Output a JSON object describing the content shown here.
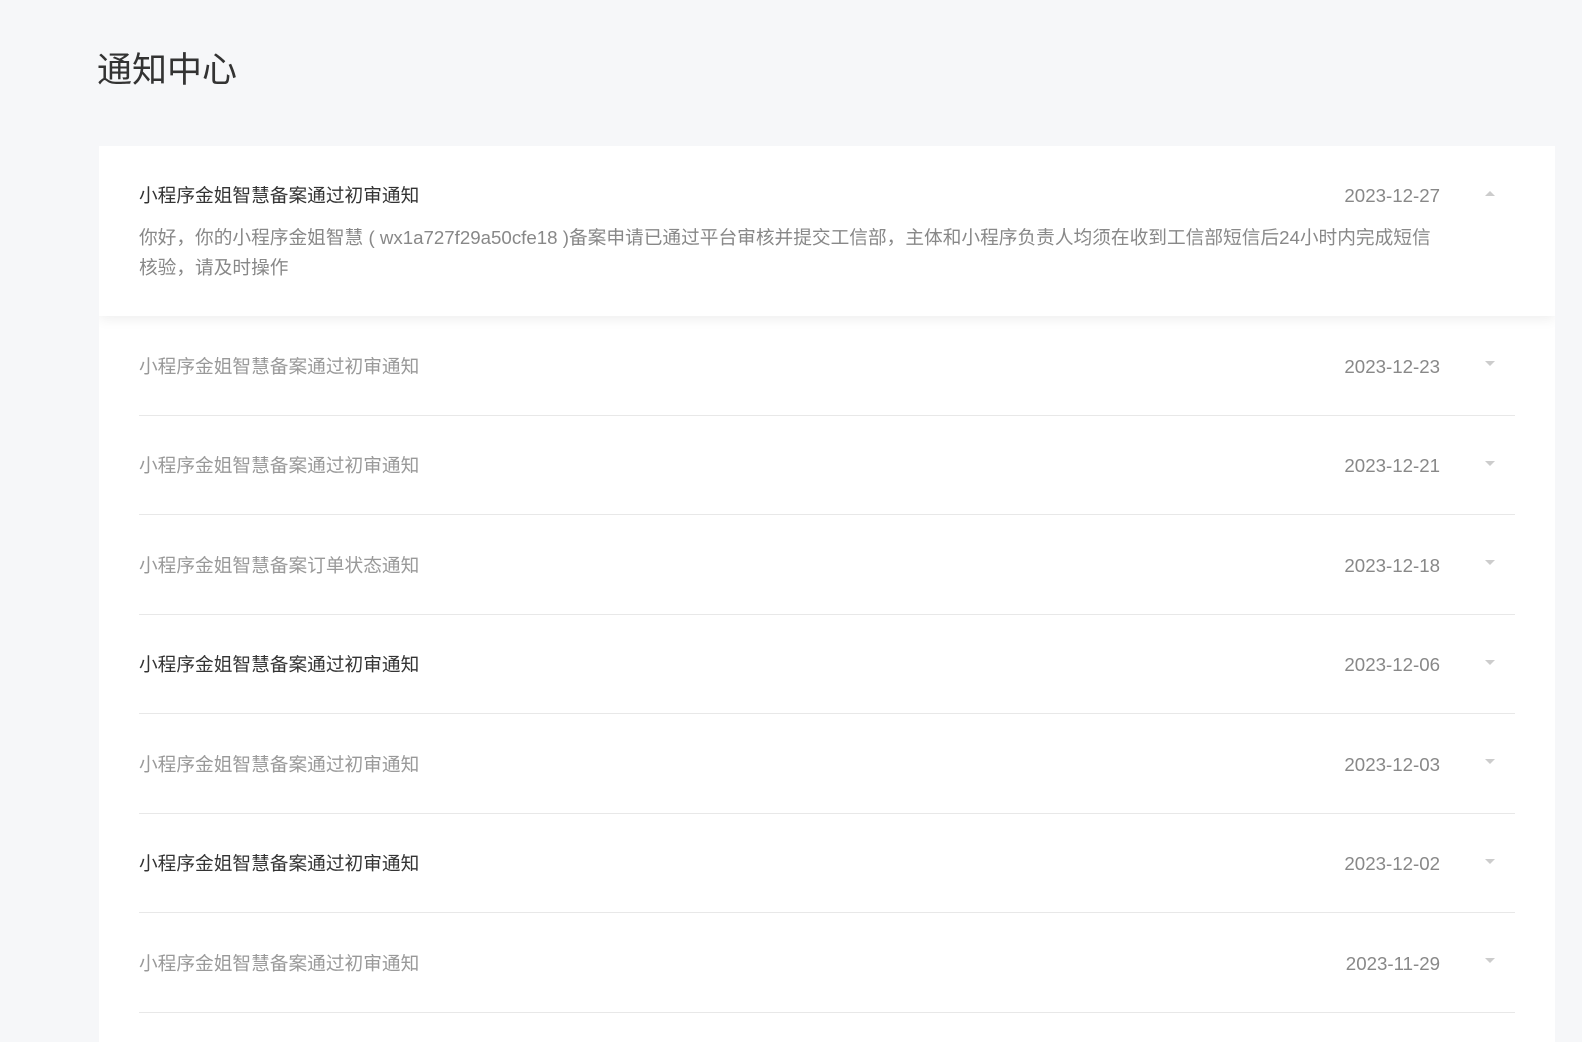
{
  "page": {
    "title": "通知中心"
  },
  "colors": {
    "background": "#f6f7f9",
    "card": "#ffffff",
    "title_unread": "#333333",
    "title_read": "#999999",
    "date": "#888888",
    "body": "#888888",
    "divider": "#e8e8e8",
    "chevron": "#cccccc"
  },
  "notifications": [
    {
      "title": "小程序金姐智慧备案通过初审通知",
      "date": "2023-12-27",
      "unread": true,
      "expanded": true,
      "icon": "chevron-up-icon",
      "body": "你好，你的小程序金姐智慧 ( wx1a727f29a50cfe18 )备案申请已通过平台审核并提交工信部，主体和小程序负责人均须在收到工信部短信后24小时内完成短信核验，请及时操作"
    },
    {
      "title": "小程序金姐智慧备案通过初审通知",
      "date": "2023-12-23",
      "unread": false,
      "expanded": false,
      "icon": "chevron-down-icon"
    },
    {
      "title": "小程序金姐智慧备案通过初审通知",
      "date": "2023-12-21",
      "unread": false,
      "expanded": false,
      "icon": "chevron-down-icon"
    },
    {
      "title": "小程序金姐智慧备案订单状态通知",
      "date": "2023-12-18",
      "unread": false,
      "expanded": false,
      "icon": "chevron-down-icon"
    },
    {
      "title": "小程序金姐智慧备案通过初审通知",
      "date": "2023-12-06",
      "unread": true,
      "expanded": false,
      "icon": "chevron-down-icon"
    },
    {
      "title": "小程序金姐智慧备案通过初审通知",
      "date": "2023-12-03",
      "unread": false,
      "expanded": false,
      "icon": "chevron-down-icon"
    },
    {
      "title": "小程序金姐智慧备案通过初审通知",
      "date": "2023-12-02",
      "unread": true,
      "expanded": false,
      "icon": "chevron-down-icon"
    },
    {
      "title": "小程序金姐智慧备案通过初审通知",
      "date": "2023-11-29",
      "unread": false,
      "expanded": false,
      "icon": "chevron-down-icon"
    }
  ]
}
